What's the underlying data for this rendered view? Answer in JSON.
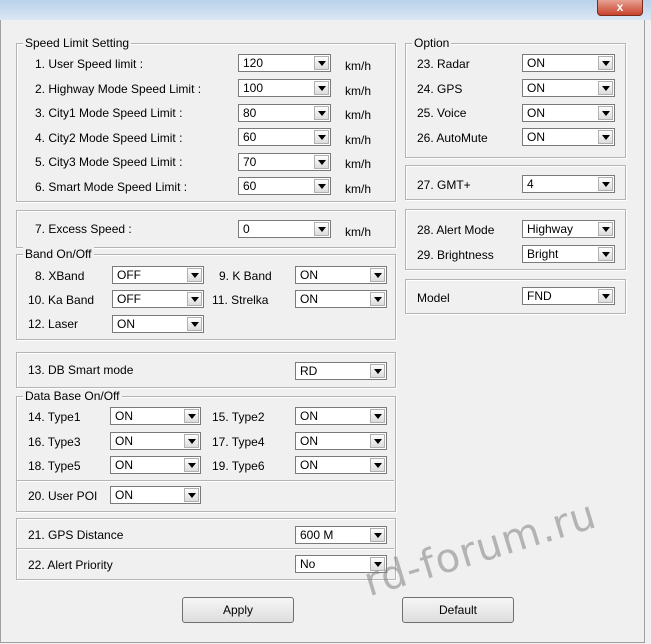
{
  "window": {
    "close_glyph": "x"
  },
  "speed": {
    "legend": "Speed Limit Setting",
    "rows": [
      {
        "label": "1. User Speed limit :",
        "value": "120",
        "unit": "km/h"
      },
      {
        "label": "2. Highway Mode Speed Limit :",
        "value": "100",
        "unit": "km/h"
      },
      {
        "label": "3. City1 Mode Speed Limit :",
        "value": "80",
        "unit": "km/h"
      },
      {
        "label": "4. City2 Mode Speed Limit :",
        "value": "60",
        "unit": "km/h"
      },
      {
        "label": "5. City3 Mode Speed Limit :",
        "value": "70",
        "unit": "km/h"
      },
      {
        "label": "6. Smart Mode Speed Limit :",
        "value": "60",
        "unit": "km/h"
      }
    ]
  },
  "excess": {
    "label": "7. Excess Speed :",
    "value": "0",
    "unit": "km/h"
  },
  "band": {
    "legend": "Band On/Off",
    "xband": {
      "label": "8. XBand",
      "value": "OFF"
    },
    "kband": {
      "label": "9. K Band",
      "value": "ON"
    },
    "kaband": {
      "label": "10. Ka Band",
      "value": "OFF"
    },
    "strelka": {
      "label": "11. Strelka",
      "value": "ON"
    },
    "laser": {
      "label": "12. Laser",
      "value": "ON"
    }
  },
  "dbsmart": {
    "label": "13. DB Smart mode",
    "value": "RD"
  },
  "database": {
    "legend": "Data Base On/Off",
    "type1": {
      "label": "14. Type1",
      "value": "ON"
    },
    "type2": {
      "label": "15. Type2",
      "value": "ON"
    },
    "type3": {
      "label": "16. Type3",
      "value": "ON"
    },
    "type4": {
      "label": "17. Type4",
      "value": "ON"
    },
    "type5": {
      "label": "18. Type5",
      "value": "ON"
    },
    "type6": {
      "label": "19. Type6",
      "value": "ON"
    },
    "userpoi": {
      "label": "20. User POI",
      "value": "ON"
    }
  },
  "gps_distance": {
    "label": "21. GPS Distance",
    "value": "600 M"
  },
  "alert_priority": {
    "label": "22. Alert Priority",
    "value": "No"
  },
  "option": {
    "legend": "Option",
    "rows": [
      {
        "label": "23. Radar",
        "value": "ON"
      },
      {
        "label": "24. GPS",
        "value": "ON"
      },
      {
        "label": "25. Voice",
        "value": "ON"
      },
      {
        "label": "26. AutoMute",
        "value": "ON"
      }
    ]
  },
  "gmt": {
    "label": "27. GMT+",
    "value": "4"
  },
  "alert_mode": {
    "label": "28. Alert Mode",
    "value": "Highway"
  },
  "brightness": {
    "label": "29. Brightness",
    "value": "Bright"
  },
  "model": {
    "label": "Model",
    "value": "FND"
  },
  "buttons": {
    "apply": "Apply",
    "default": "Default"
  },
  "watermark": "rd-forum.ru"
}
